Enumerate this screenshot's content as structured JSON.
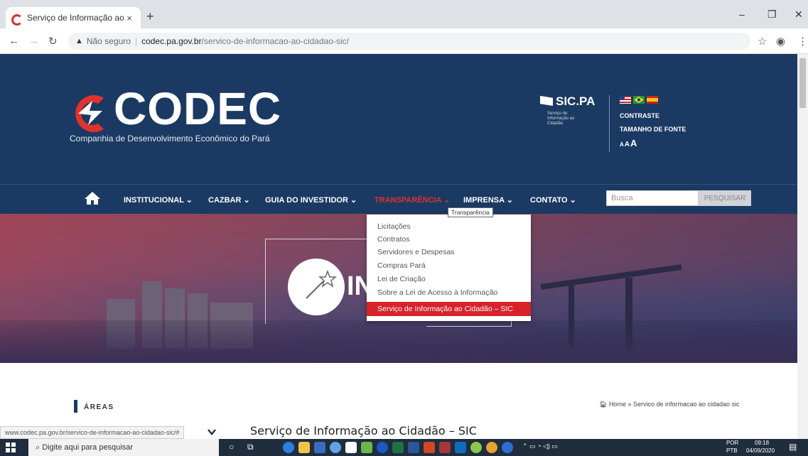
{
  "browser": {
    "tab_title": "Serviço de Informação ao Cidad",
    "tab_close": "×",
    "new_tab": "+",
    "security_label": "Não seguro",
    "url_host": "codec.pa.gov.br",
    "url_path": "/servico-de-informacao-ao-cidadao-sic/"
  },
  "header": {
    "logo_text": "CODEC",
    "logo_subtitle": "Companhia de Desenvolvimento Econômico do Pará",
    "sic_name": "SIC.PA",
    "sic_small": "Serviço de Informação ao Cidadão",
    "contrast": "CONTRASTE",
    "font_size": "TAMANHO DE FONTE",
    "aaa": [
      "A",
      "A",
      "A"
    ]
  },
  "nav": {
    "items": [
      {
        "label": "INSTITUCIONAL ⌄"
      },
      {
        "label": "CAZBAR ⌄"
      },
      {
        "label": "GUIA DO INVESTIDOR ⌄"
      },
      {
        "label": "TRANSPARÊNCIA ⌄"
      },
      {
        "label": "IMPRENSA ⌄"
      },
      {
        "label": "CONTATO ⌄"
      }
    ],
    "search_placeholder": "Busca",
    "search_button": "PESQUISAR"
  },
  "dropdown": {
    "tooltip": "Transparência",
    "items": [
      "Licitações",
      "Contratos",
      "Servidores e Despesas",
      "Compras Pará",
      "Lei de Criação",
      "Sobre a Lei de Acesso à Informação",
      "Serviço de Informação ao Cidadão – SIC"
    ]
  },
  "hero": {
    "partial_text": "IN"
  },
  "content": {
    "areas_label": "ÁREAS",
    "breadcrumb": "Home » Servico de informacao ao cidadao sic",
    "page_title": "Serviço de Informação ao Cidadão – SIC",
    "status_url": "www.codec.pa.gov.br/servico-de-informacao-ao-cidadao-sic/#"
  },
  "taskbar": {
    "search_text": "Digite aqui para pesquisar",
    "lang": "POR",
    "lang2": "PTB",
    "time": "09:18",
    "date": "04/09/2020"
  }
}
